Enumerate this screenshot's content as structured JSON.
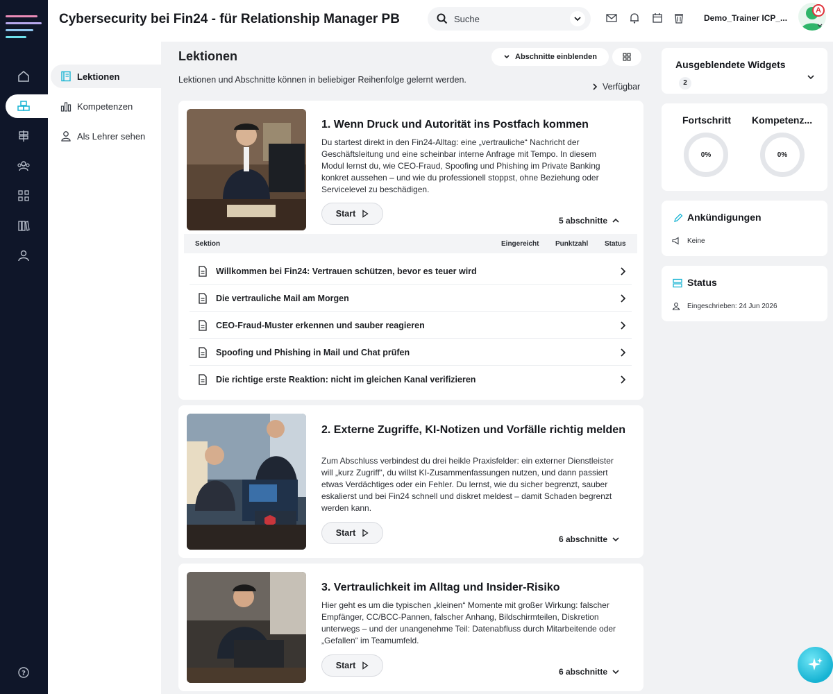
{
  "header": {
    "title": "Cybersecurity bei Fin24 - für Relationship Manager PB",
    "search_placeholder": "Suche",
    "user_name": "Demo_Trainer ICP_...",
    "avatar_badge": "A"
  },
  "subnav": {
    "items": [
      {
        "label": "Lektionen",
        "icon": "book-icon"
      },
      {
        "label": "Kompetenzen",
        "icon": "bar-chart-icon"
      },
      {
        "label": "Als Lehrer sehen",
        "icon": "user-icon"
      }
    ]
  },
  "main": {
    "title": "Lektionen",
    "show_sections_label": "Abschnitte einblenden",
    "lede": "Lektionen und Abschnitte können in beliebiger Reihenfolge gelernt werden.",
    "availability_label": "Verfügbar",
    "section_table": {
      "headers": [
        "Sektion",
        "Eingereicht",
        "Punktzahl",
        "Status"
      ]
    },
    "lessons": [
      {
        "title": "1. Wenn Druck und Autorität ins Postfach kommen",
        "description": "Du startest direkt in den Fin24-Alltag: eine „vertrauliche“ Nachricht der Geschäftsleitung und eine scheinbar interne Anfrage mit Tempo. In diesem Modul lernst du, wie CEO-Fraud, Spoofing und Phishing im Private Banking konkret aussehen – und wie du professionell stoppst, ohne Beziehung oder Servicelevel zu beschädigen.",
        "start_label": "Start",
        "sections_label": "5 abschnitte",
        "sections": [
          "Willkommen bei Fin24: Vertrauen schützen, bevor es teuer wird",
          "Die vertrauliche Mail am Morgen",
          "CEO-Fraud-Muster erkennen und sauber reagieren",
          "Spoofing und Phishing in Mail und Chat prüfen",
          "Die richtige erste Reaktion: nicht im gleichen Kanal verifizieren"
        ]
      },
      {
        "title": "2. Externe Zugriffe, KI-Notizen und Vorfälle richtig melden",
        "description": "Zum Abschluss verbindest du drei heikle Praxisfelder: ein externer Dienstleister will „kurz Zugriff“, du willst KI-Zusammenfassungen nutzen, und dann passiert etwas Verdächtiges oder ein Fehler. Du lernst, wie du sicher begrenzt, sauber eskalierst und bei Fin24 schnell und diskret meldest – damit Schaden begrenzt werden kann.",
        "start_label": "Start",
        "sections_label": "6 abschnitte"
      },
      {
        "title": "3. Vertraulichkeit im Alltag und Insider-Risiko",
        "description": "Hier geht es um die typischen „kleinen“ Momente mit großer Wirkung: falscher Empfänger, CC/BCC-Pannen, falscher Anhang, Bildschirmteilen, Diskretion unterwegs – und der unangenehme Teil: Datenabfluss durch Mitarbeitende oder „Gefallen“ im Teamumfeld.",
        "start_label": "Start",
        "sections_label": "6 abschnitte"
      }
    ]
  },
  "right": {
    "hidden_widgets": {
      "title": "Ausgeblendete Widgets",
      "count": "2"
    },
    "progress": {
      "title": "Fortschritt",
      "value": "0%"
    },
    "competence": {
      "title": "Kompetenz...",
      "value": "0%"
    },
    "announcements": {
      "title": "Ankündigungen",
      "text": "Keine"
    },
    "status": {
      "title": "Status",
      "enrolled": "Eingeschrieben: 24 Jun 2026"
    }
  },
  "colors": {
    "rail": "#0f1629",
    "accent": "#17b3d3",
    "badge_red": "#e0323a"
  }
}
